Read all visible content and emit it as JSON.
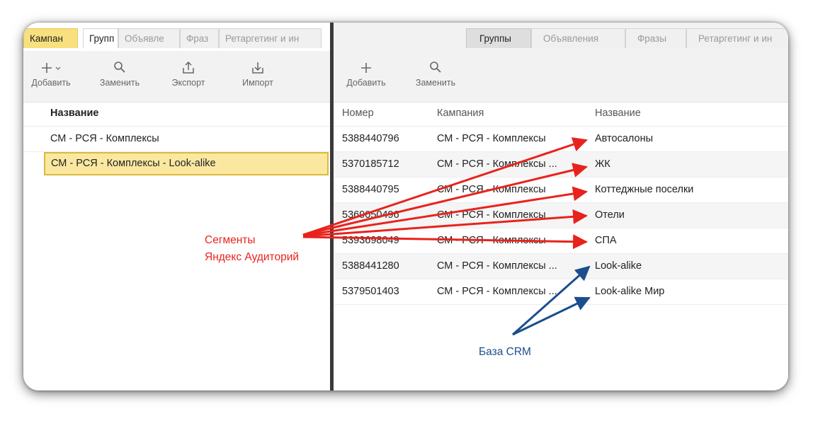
{
  "left_panel": {
    "tabs": [
      "Кампан",
      "Групп",
      "Объявле",
      "Фраз",
      "Ретаргетинг и ин"
    ],
    "toolbar": {
      "add": "Добавить",
      "replace": "Заменить",
      "export": "Экспорт",
      "import": "Импорт"
    },
    "table": {
      "header_name": "Название",
      "rows": [
        "СМ - РСЯ - Комплексы",
        "СМ - РСЯ - Комплексы - Look-alike"
      ]
    }
  },
  "right_panel": {
    "tabs": [
      "Группы",
      "Объявления",
      "Фразы",
      "Ретаргетинг и ин"
    ],
    "toolbar": {
      "add": "Добавить",
      "replace": "Заменить"
    },
    "table": {
      "headers": {
        "number": "Номер",
        "campaign": "Кампания",
        "name": "Название"
      },
      "rows": [
        {
          "number": "5388440796",
          "campaign": "СМ - РСЯ - Комплексы",
          "name": "Автосалоны"
        },
        {
          "number": "5370185712",
          "campaign": "СМ - РСЯ - Комплексы ...",
          "name": "ЖК"
        },
        {
          "number": "5388440795",
          "campaign": "СМ - РСЯ - Комплексы",
          "name": "Коттеджные поселки"
        },
        {
          "number": "5369050496",
          "campaign": "СМ - РСЯ - Комплексы",
          "name": "Отели"
        },
        {
          "number": "5393698049",
          "campaign": "СМ - РСЯ - Комплексы",
          "name": "СПА"
        },
        {
          "number": "5388441280",
          "campaign": "СМ - РСЯ - Комплексы ...",
          "name": "Look-alike"
        },
        {
          "number": "5379501403",
          "campaign": "СМ - РСЯ - Комплексы ...",
          "name": "Look-alike Мир"
        }
      ]
    }
  },
  "annotations": {
    "segments_line1": "Сегменты",
    "segments_line2": "Яндекс Аудиторий",
    "crm": "База CRM"
  },
  "colors": {
    "annotation_red": "#e8231d",
    "annotation_blue": "#1b4e8c",
    "selection_fill": "#fbe8a0",
    "selection_border": "#dcb93a",
    "active_campaign_tab": "#f8e07e"
  }
}
